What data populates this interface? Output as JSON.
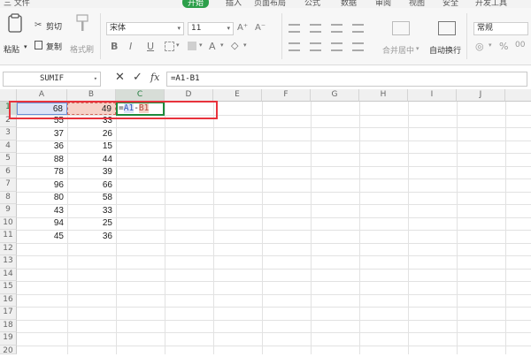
{
  "menu": [
    {
      "label": "三 文件",
      "active": false
    },
    {
      "label": "开始",
      "active": true
    },
    {
      "label": "插入",
      "active": false
    },
    {
      "label": "页面布局",
      "active": false
    },
    {
      "label": "公式",
      "active": false
    },
    {
      "label": "数据",
      "active": false
    },
    {
      "label": "审阅",
      "active": false
    },
    {
      "label": "视图",
      "active": false
    },
    {
      "label": "安全",
      "active": false
    },
    {
      "label": "开发工具",
      "active": false
    }
  ],
  "ribbon": {
    "paste_label": "粘贴",
    "cut_label": "剪切",
    "copy_label": "复制",
    "format_painter_label": "格式刷",
    "font_name": "宋体",
    "font_size": "11",
    "merge_label": "合并居中",
    "wrap_label": "自动换行",
    "number_format": "常规"
  },
  "formula_bar": {
    "name_box": "SUMIF",
    "cancel_icon": "✕",
    "enter_icon": "✓",
    "fx_label": "fx",
    "formula": "=A1-B1"
  },
  "columns": [
    "A",
    "B",
    "C",
    "D",
    "E",
    "F",
    "G",
    "H",
    "I",
    "J"
  ],
  "rows": [
    "1",
    "2",
    "3",
    "4",
    "5",
    "6",
    "7",
    "8",
    "9",
    "10",
    "11",
    "12",
    "13",
    "14",
    "15",
    "16",
    "17",
    "18",
    "19",
    "20"
  ],
  "data": {
    "col_a": [
      "68",
      "55",
      "37",
      "36",
      "88",
      "78",
      "96",
      "80",
      "43",
      "94",
      "45"
    ],
    "col_b": [
      "49",
      "33",
      "26",
      "15",
      "44",
      "39",
      "66",
      "58",
      "33",
      "25",
      "36"
    ]
  },
  "edit_cell": {
    "prefix": "=",
    "ref_a": "A1",
    "operator": "-",
    "ref_b": "B1"
  },
  "colors": {
    "active_tab": "#2c9f4a",
    "highlight_box": "#e8323c",
    "ref_a_fill": "#dde4f7",
    "ref_b_fill": "#f6d2c8",
    "active_cell_border": "#1e8a3c"
  }
}
